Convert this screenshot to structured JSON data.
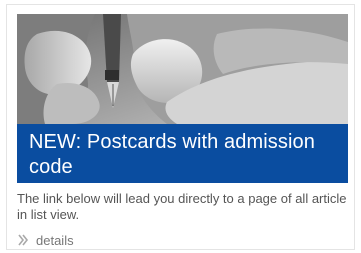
{
  "teaser": {
    "title": "NEW: Postcards with admission code",
    "image_subject": "hands-with-fountain-pen-photo",
    "title_background": "#0a4da0"
  },
  "description": "The link below will lead you directly to a page of all article in list view.",
  "link": {
    "label": "details",
    "icon": "double-chevron-right-icon"
  }
}
